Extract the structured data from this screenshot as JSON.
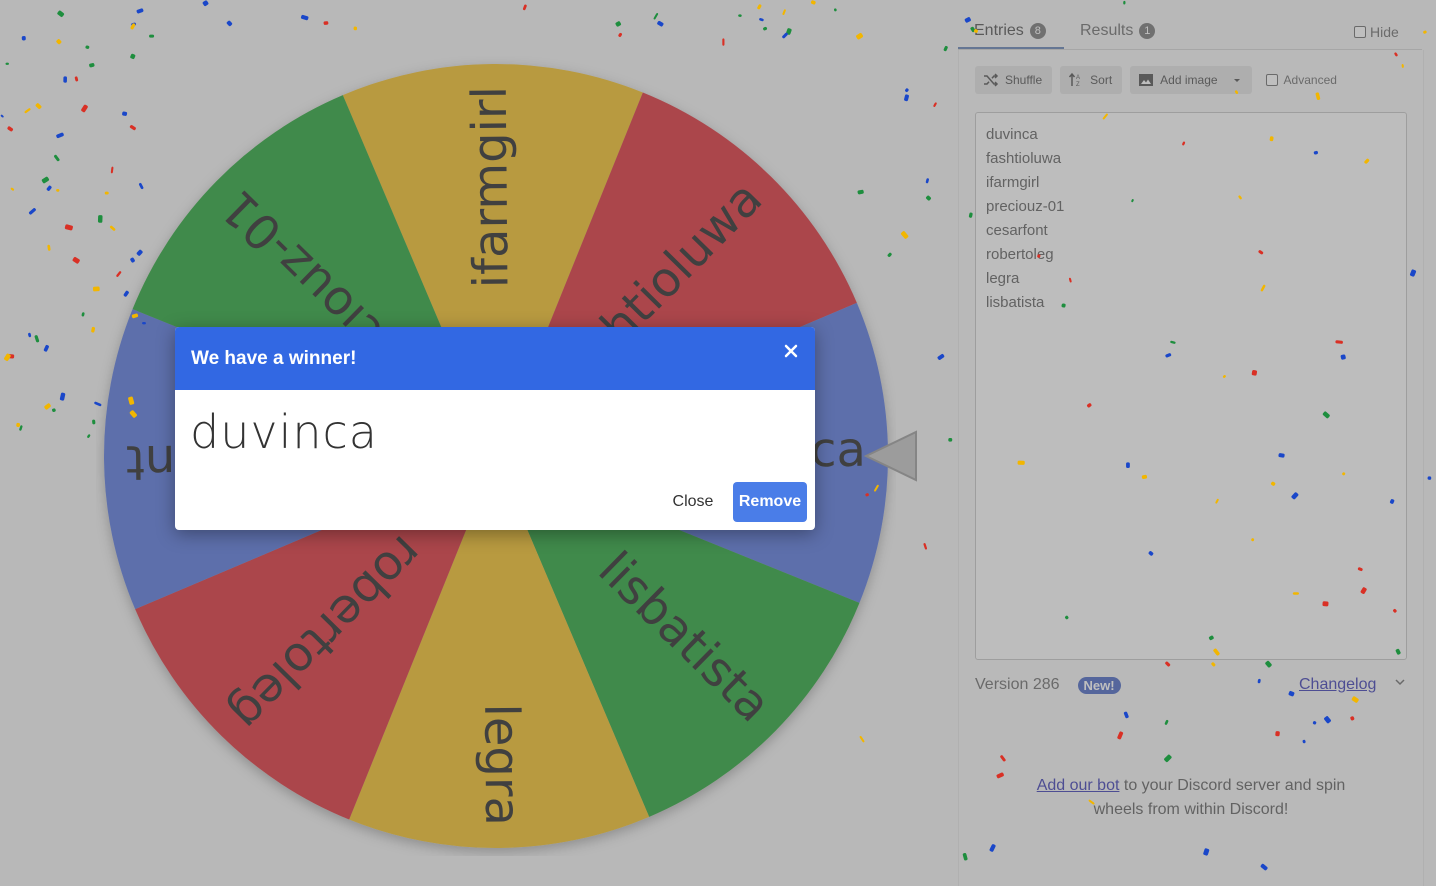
{
  "tabs": {
    "entries_label": "Entries",
    "entries_count": "8",
    "results_label": "Results",
    "results_count": "1",
    "hide_label": "Hide"
  },
  "toolbar": {
    "shuffle_label": "Shuffle",
    "sort_label": "Sort",
    "add_image_label": "Add image",
    "advanced_label": "Advanced"
  },
  "entries": [
    "duvinca",
    "fashtioluwa",
    "ifarmgirl",
    "preciouz-01",
    "cesarfont",
    "robertoleg",
    "legra",
    "lisbatista"
  ],
  "footer": {
    "version_label": "Version 286",
    "new_badge": "New!",
    "changelog_label": "Changelog",
    "discord_link": "Add our bot",
    "discord_text_1": " to your Discord server and spin",
    "discord_text_2": "wheels from within Discord!"
  },
  "wheel": {
    "segments": [
      {
        "label": "ifarmgirl",
        "color": "#f0b400"
      },
      {
        "label": "fashtioluwa",
        "color": "#d60a15"
      },
      {
        "label": "duvinca",
        "color": "#3b5fd6"
      },
      {
        "label": "lisbatista",
        "color": "#009412"
      },
      {
        "label": "legra",
        "color": "#f0b400"
      },
      {
        "label": "robertoleg",
        "color": "#d60a15"
      },
      {
        "label": "cesarfont",
        "color": "#3b5fd6"
      },
      {
        "label": "preciouz-01",
        "color": "#009412"
      }
    ]
  },
  "dialog": {
    "title": "We have a winner!",
    "winner": "duvinca",
    "close_label": "Close",
    "remove_label": "Remove"
  },
  "colors": {
    "dialog_header": "#3268e3",
    "remove_button": "#4a7de8",
    "new_badge": "#2a4db8"
  }
}
